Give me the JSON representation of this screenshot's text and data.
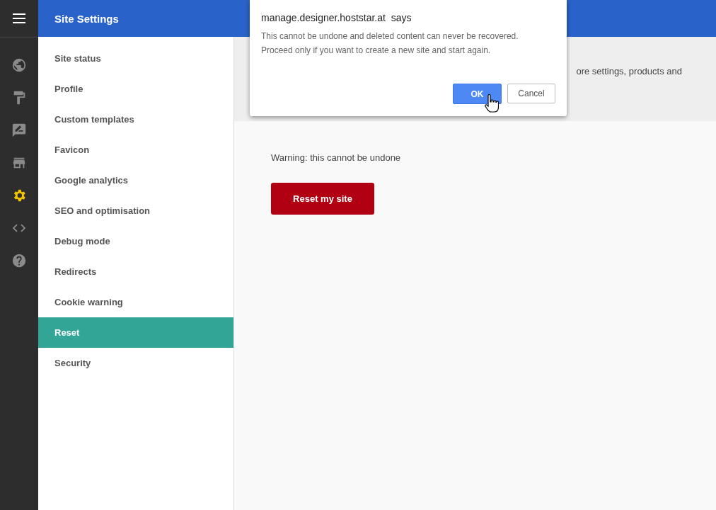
{
  "header": {
    "title": "Site Settings"
  },
  "rail": [
    {
      "kind": "globe",
      "selected": false
    },
    {
      "kind": "roller",
      "selected": false
    },
    {
      "kind": "feedback",
      "selected": false
    },
    {
      "kind": "store",
      "selected": false
    },
    {
      "kind": "gear",
      "selected": true
    },
    {
      "kind": "code",
      "selected": false
    },
    {
      "kind": "help",
      "selected": false
    }
  ],
  "nav": [
    {
      "label": "Site status",
      "selected": false
    },
    {
      "label": "Profile",
      "selected": false
    },
    {
      "label": "Custom templates",
      "selected": false
    },
    {
      "label": "Favicon",
      "selected": false
    },
    {
      "label": "Google analytics",
      "selected": false
    },
    {
      "label": "SEO and optimisation",
      "selected": false
    },
    {
      "label": "Debug mode",
      "selected": false
    },
    {
      "label": "Redirects",
      "selected": false
    },
    {
      "label": "Cookie warning",
      "selected": false
    },
    {
      "label": "Reset",
      "selected": true
    },
    {
      "label": "Security",
      "selected": false
    }
  ],
  "banner": {
    "text": "ore settings, products and"
  },
  "content": {
    "warning": "Warning: this cannot be undone",
    "button": "Reset my site"
  },
  "dialog": {
    "title": "manage.designer.hoststar.at  says",
    "message": [
      "This cannot be undone and deleted content can never be recovered.",
      "Proceed only if you want to create a new site and start again."
    ],
    "ok": "OK",
    "cancel": "Cancel"
  }
}
